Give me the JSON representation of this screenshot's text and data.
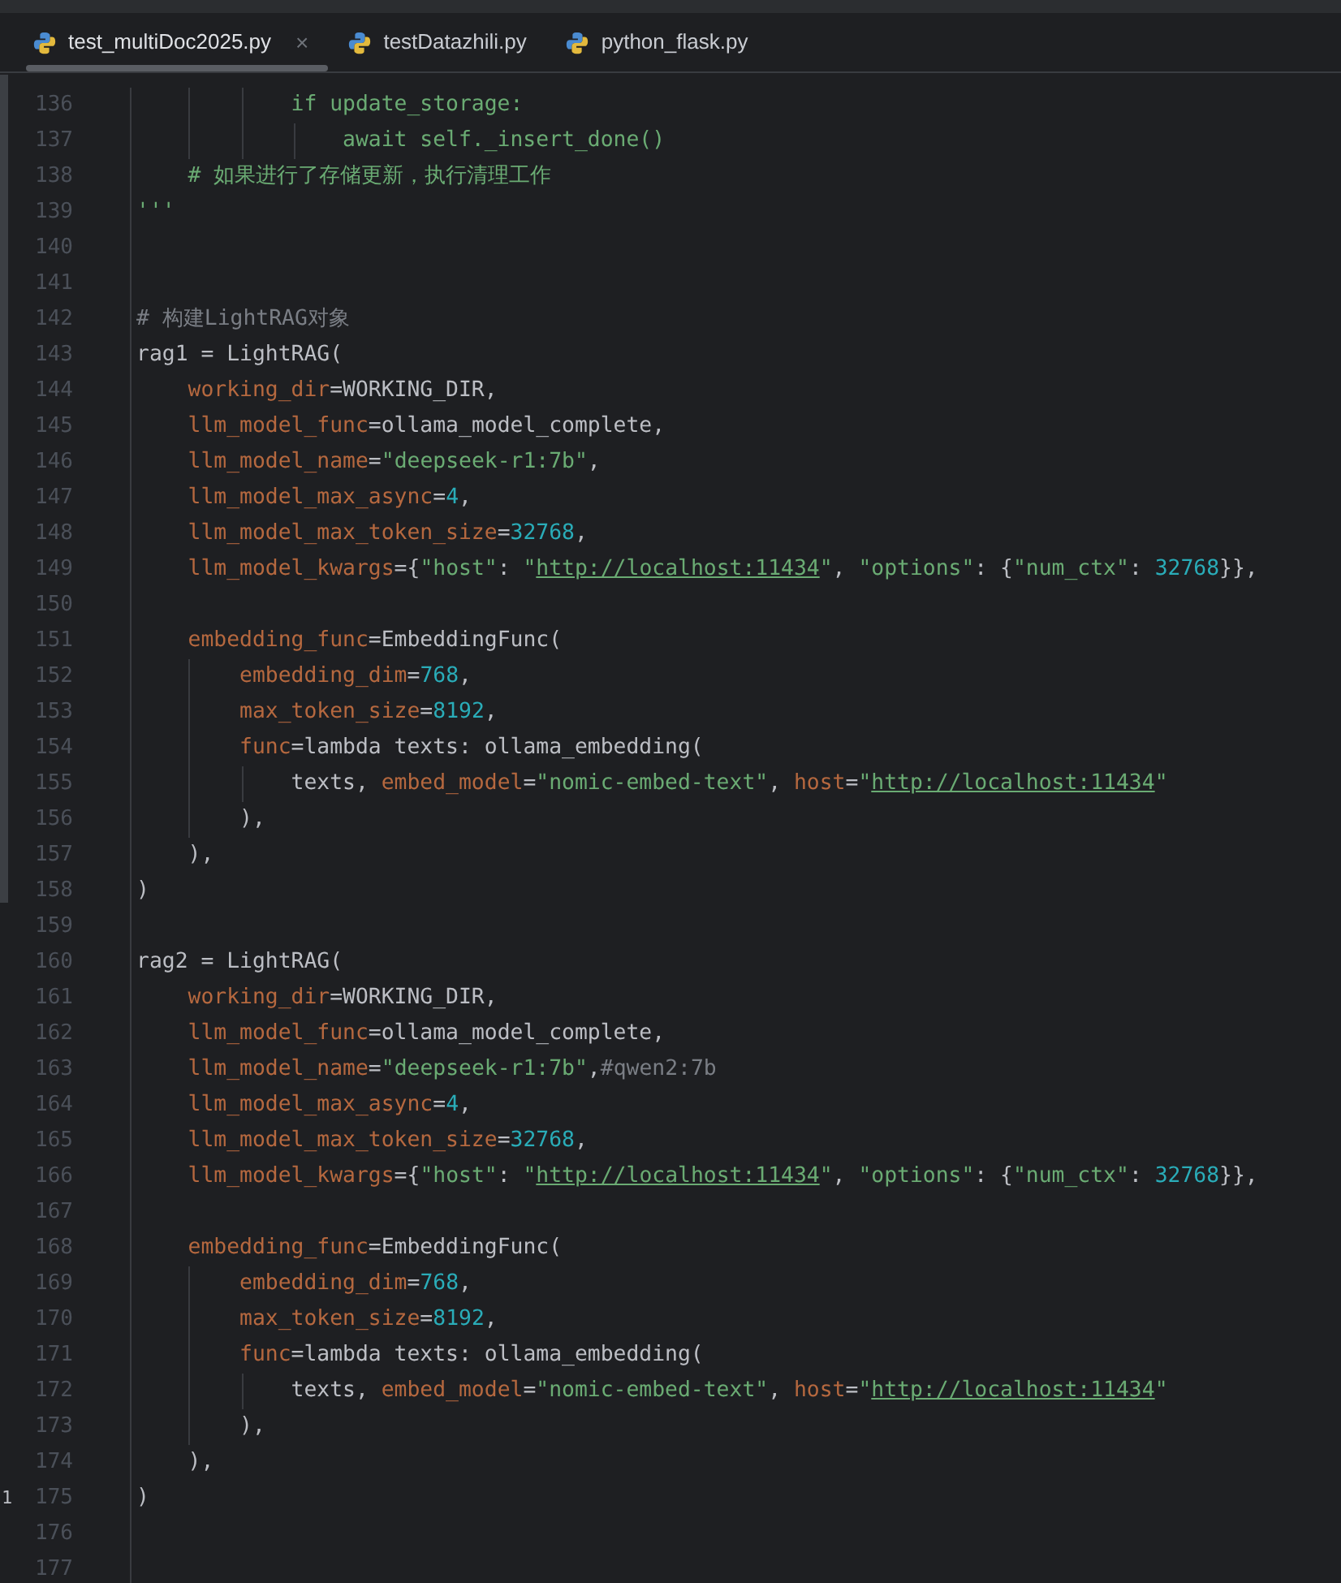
{
  "tabs": [
    {
      "label": "test_multiDoc2025.py",
      "selected": true,
      "close": "×"
    },
    {
      "label": "testDatazhili.py",
      "selected": false
    },
    {
      "label": "python_flask.py",
      "selected": false
    }
  ],
  "lines": [
    {
      "number": "136",
      "tokens": [
        {
          "kind": "docstring",
          "text": "            if update_storage:"
        }
      ]
    },
    {
      "number": "137",
      "tokens": [
        {
          "kind": "docstring",
          "text": "                await self._insert_done()"
        }
      ]
    },
    {
      "number": "138",
      "tokens": [
        {
          "kind": "docstring",
          "text": "    # 如果进行了存储更新，执行清理工作"
        }
      ]
    },
    {
      "number": "139",
      "tokens": [
        {
          "kind": "docstring",
          "text": "'''"
        }
      ]
    },
    {
      "number": "140"
    },
    {
      "number": "141"
    },
    {
      "number": "142",
      "tokens": [
        {
          "kind": "comment",
          "text": "# 构建LightRAG对象"
        }
      ]
    },
    {
      "number": "143",
      "tokens": [
        {
          "kind": "plain",
          "text": "rag1 = LightRAG("
        }
      ]
    },
    {
      "number": "144",
      "tokens": [
        {
          "kind": "param",
          "text": "    working_dir"
        },
        {
          "kind": "plain",
          "text": "=WORKING_DIR,"
        }
      ]
    },
    {
      "number": "145",
      "tokens": [
        {
          "kind": "param",
          "text": "    llm_model_func"
        },
        {
          "kind": "plain",
          "text": "=ollama_model_complete,"
        }
      ]
    },
    {
      "number": "146",
      "tokens": [
        {
          "kind": "param",
          "text": "    llm_model_name"
        },
        {
          "kind": "plain",
          "text": "="
        },
        {
          "kind": "string",
          "text": "\"deepseek-r1:7b\""
        },
        {
          "kind": "plain",
          "text": ","
        }
      ]
    },
    {
      "number": "147",
      "tokens": [
        {
          "kind": "param",
          "text": "    llm_model_max_async"
        },
        {
          "kind": "plain",
          "text": "="
        },
        {
          "kind": "number",
          "text": "4"
        },
        {
          "kind": "plain",
          "text": ","
        }
      ]
    },
    {
      "number": "148",
      "tokens": [
        {
          "kind": "param",
          "text": "    llm_model_max_token_size"
        },
        {
          "kind": "plain",
          "text": "="
        },
        {
          "kind": "number",
          "text": "32768"
        },
        {
          "kind": "plain",
          "text": ","
        }
      ]
    },
    {
      "number": "149",
      "tokens": [
        {
          "kind": "param",
          "text": "    llm_model_kwargs"
        },
        {
          "kind": "plain",
          "text": "={"
        },
        {
          "kind": "string",
          "text": "\"host\""
        },
        {
          "kind": "plain",
          "text": ": "
        },
        {
          "kind": "string",
          "text": "\""
        },
        {
          "kind": "link",
          "text": "http://localhost:11434"
        },
        {
          "kind": "string",
          "text": "\""
        },
        {
          "kind": "plain",
          "text": ", "
        },
        {
          "kind": "string",
          "text": "\"options\""
        },
        {
          "kind": "plain",
          "text": ": {"
        },
        {
          "kind": "string",
          "text": "\"num_ctx\""
        },
        {
          "kind": "plain",
          "text": ": "
        },
        {
          "kind": "number",
          "text": "32768"
        },
        {
          "kind": "plain",
          "text": "}},"
        }
      ]
    },
    {
      "number": "150"
    },
    {
      "number": "151",
      "tokens": [
        {
          "kind": "param",
          "text": "    embedding_func"
        },
        {
          "kind": "plain",
          "text": "=EmbeddingFunc("
        }
      ]
    },
    {
      "number": "152",
      "tokens": [
        {
          "kind": "param",
          "text": "        embedding_dim"
        },
        {
          "kind": "plain",
          "text": "="
        },
        {
          "kind": "number",
          "text": "768"
        },
        {
          "kind": "plain",
          "text": ","
        }
      ]
    },
    {
      "number": "153",
      "tokens": [
        {
          "kind": "param",
          "text": "        max_token_size"
        },
        {
          "kind": "plain",
          "text": "="
        },
        {
          "kind": "number",
          "text": "8192"
        },
        {
          "kind": "plain",
          "text": ","
        }
      ]
    },
    {
      "number": "154",
      "tokens": [
        {
          "kind": "param",
          "text": "        func"
        },
        {
          "kind": "plain",
          "text": "=lambda texts: ollama_embedding("
        }
      ]
    },
    {
      "number": "155",
      "tokens": [
        {
          "kind": "plain",
          "text": "            texts, "
        },
        {
          "kind": "param",
          "text": "embed_model"
        },
        {
          "kind": "plain",
          "text": "="
        },
        {
          "kind": "string",
          "text": "\"nomic-embed-text\""
        },
        {
          "kind": "plain",
          "text": ", "
        },
        {
          "kind": "param",
          "text": "host"
        },
        {
          "kind": "plain",
          "text": "="
        },
        {
          "kind": "string",
          "text": "\""
        },
        {
          "kind": "link",
          "text": "http://localhost:11434"
        },
        {
          "kind": "string",
          "text": "\""
        }
      ]
    },
    {
      "number": "156",
      "tokens": [
        {
          "kind": "plain",
          "text": "        ),"
        }
      ]
    },
    {
      "number": "157",
      "tokens": [
        {
          "kind": "plain",
          "text": "    ),"
        }
      ]
    },
    {
      "number": "158",
      "tokens": [
        {
          "kind": "plain",
          "text": ")"
        }
      ]
    },
    {
      "number": "159"
    },
    {
      "number": "160",
      "tokens": [
        {
          "kind": "plain",
          "text": "rag2 = LightRAG("
        }
      ]
    },
    {
      "number": "161",
      "tokens": [
        {
          "kind": "param",
          "text": "    working_dir"
        },
        {
          "kind": "plain",
          "text": "=WORKING_DIR,"
        }
      ]
    },
    {
      "number": "162",
      "tokens": [
        {
          "kind": "param",
          "text": "    llm_model_func"
        },
        {
          "kind": "plain",
          "text": "=ollama_model_complete,"
        }
      ]
    },
    {
      "number": "163",
      "tokens": [
        {
          "kind": "param",
          "text": "    llm_model_name"
        },
        {
          "kind": "plain",
          "text": "="
        },
        {
          "kind": "string",
          "text": "\"deepseek-r1:7b\""
        },
        {
          "kind": "plain",
          "text": ","
        },
        {
          "kind": "comment",
          "text": "#qwen2:7b"
        }
      ]
    },
    {
      "number": "164",
      "tokens": [
        {
          "kind": "param",
          "text": "    llm_model_max_async"
        },
        {
          "kind": "plain",
          "text": "="
        },
        {
          "kind": "number",
          "text": "4"
        },
        {
          "kind": "plain",
          "text": ","
        }
      ]
    },
    {
      "number": "165",
      "tokens": [
        {
          "kind": "param",
          "text": "    llm_model_max_token_size"
        },
        {
          "kind": "plain",
          "text": "="
        },
        {
          "kind": "number",
          "text": "32768"
        },
        {
          "kind": "plain",
          "text": ","
        }
      ]
    },
    {
      "number": "166",
      "tokens": [
        {
          "kind": "param",
          "text": "    llm_model_kwargs"
        },
        {
          "kind": "plain",
          "text": "={"
        },
        {
          "kind": "string",
          "text": "\"host\""
        },
        {
          "kind": "plain",
          "text": ": "
        },
        {
          "kind": "string",
          "text": "\""
        },
        {
          "kind": "link",
          "text": "http://localhost:11434"
        },
        {
          "kind": "string",
          "text": "\""
        },
        {
          "kind": "plain",
          "text": ", "
        },
        {
          "kind": "string",
          "text": "\"options\""
        },
        {
          "kind": "plain",
          "text": ": {"
        },
        {
          "kind": "string",
          "text": "\"num_ctx\""
        },
        {
          "kind": "plain",
          "text": ": "
        },
        {
          "kind": "number",
          "text": "32768"
        },
        {
          "kind": "plain",
          "text": "}},"
        }
      ]
    },
    {
      "number": "167"
    },
    {
      "number": "168",
      "tokens": [
        {
          "kind": "param",
          "text": "    embedding_func"
        },
        {
          "kind": "plain",
          "text": "=EmbeddingFunc("
        }
      ]
    },
    {
      "number": "169",
      "tokens": [
        {
          "kind": "param",
          "text": "        embedding_dim"
        },
        {
          "kind": "plain",
          "text": "="
        },
        {
          "kind": "number",
          "text": "768"
        },
        {
          "kind": "plain",
          "text": ","
        }
      ]
    },
    {
      "number": "170",
      "tokens": [
        {
          "kind": "param",
          "text": "        max_token_size"
        },
        {
          "kind": "plain",
          "text": "="
        },
        {
          "kind": "number",
          "text": "8192"
        },
        {
          "kind": "plain",
          "text": ","
        }
      ]
    },
    {
      "number": "171",
      "tokens": [
        {
          "kind": "param",
          "text": "        func"
        },
        {
          "kind": "plain",
          "text": "=lambda texts: ollama_embedding("
        }
      ]
    },
    {
      "number": "172",
      "tokens": [
        {
          "kind": "plain",
          "text": "            texts, "
        },
        {
          "kind": "param",
          "text": "embed_model"
        },
        {
          "kind": "plain",
          "text": "="
        },
        {
          "kind": "string",
          "text": "\"nomic-embed-text\""
        },
        {
          "kind": "plain",
          "text": ", "
        },
        {
          "kind": "param",
          "text": "host"
        },
        {
          "kind": "plain",
          "text": "="
        },
        {
          "kind": "string",
          "text": "\""
        },
        {
          "kind": "link",
          "text": "http://localhost:11434"
        },
        {
          "kind": "string",
          "text": "\""
        }
      ]
    },
    {
      "number": "173",
      "tokens": [
        {
          "kind": "plain",
          "text": "        ),"
        }
      ]
    },
    {
      "number": "174",
      "tokens": [
        {
          "kind": "plain",
          "text": "    ),"
        }
      ]
    },
    {
      "number": "175",
      "gutter_mark": "1",
      "tokens": [
        {
          "kind": "plain",
          "text": ")"
        }
      ]
    },
    {
      "number": "176"
    },
    {
      "number": "177"
    }
  ]
}
